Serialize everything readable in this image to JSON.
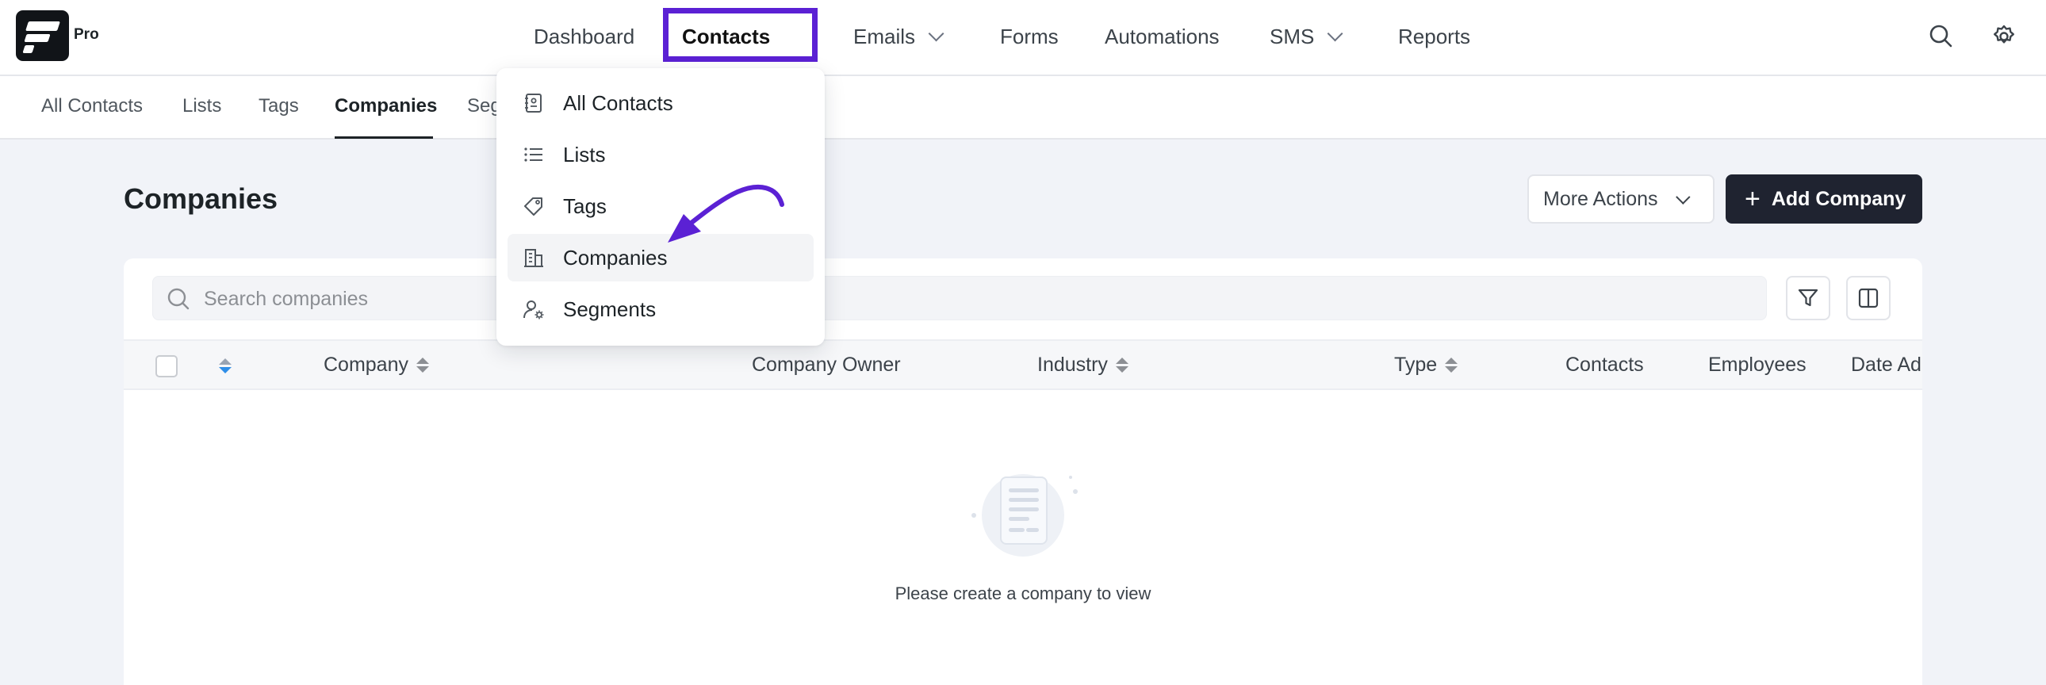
{
  "brand": {
    "badge": "Pro"
  },
  "nav": {
    "items": [
      {
        "label": "Dashboard",
        "has_chevron": false
      },
      {
        "label": "Contacts",
        "has_chevron": true
      },
      {
        "label": "Emails",
        "has_chevron": true
      },
      {
        "label": "Forms",
        "has_chevron": false
      },
      {
        "label": "Automations",
        "has_chevron": false
      },
      {
        "label": "SMS",
        "has_chevron": true
      },
      {
        "label": "Reports",
        "has_chevron": false
      }
    ],
    "active": "Contacts",
    "highlight_color": "#5b21d4",
    "icons": [
      "search-icon",
      "gear-icon"
    ]
  },
  "subtabs": {
    "items": [
      "All Contacts",
      "Lists",
      "Tags",
      "Companies",
      "Seg"
    ],
    "active": "Companies"
  },
  "dropdown": {
    "items": [
      {
        "label": "All Contacts",
        "icon": "contact-book-icon"
      },
      {
        "label": "Lists",
        "icon": "list-icon"
      },
      {
        "label": "Tags",
        "icon": "tag-icon"
      },
      {
        "label": "Companies",
        "icon": "building-icon"
      },
      {
        "label": "Segments",
        "icon": "user-gear-icon"
      }
    ],
    "highlighted": "Companies"
  },
  "page": {
    "title": "Companies",
    "more_actions_label": "More Actions",
    "add_button_label": "Add Company",
    "add_button_color": "#1f2330"
  },
  "search": {
    "placeholder": "Search companies",
    "value": ""
  },
  "table": {
    "columns": [
      "Company",
      "Company Owner",
      "Industry",
      "Type",
      "Contacts",
      "Employees",
      "Date Ad"
    ],
    "sortable": [
      "Company",
      "Industry",
      "Type"
    ],
    "rows": []
  },
  "empty_state": {
    "message": "Please create a company to view"
  },
  "annotation": {
    "arrow_color": "#5b21d4"
  }
}
